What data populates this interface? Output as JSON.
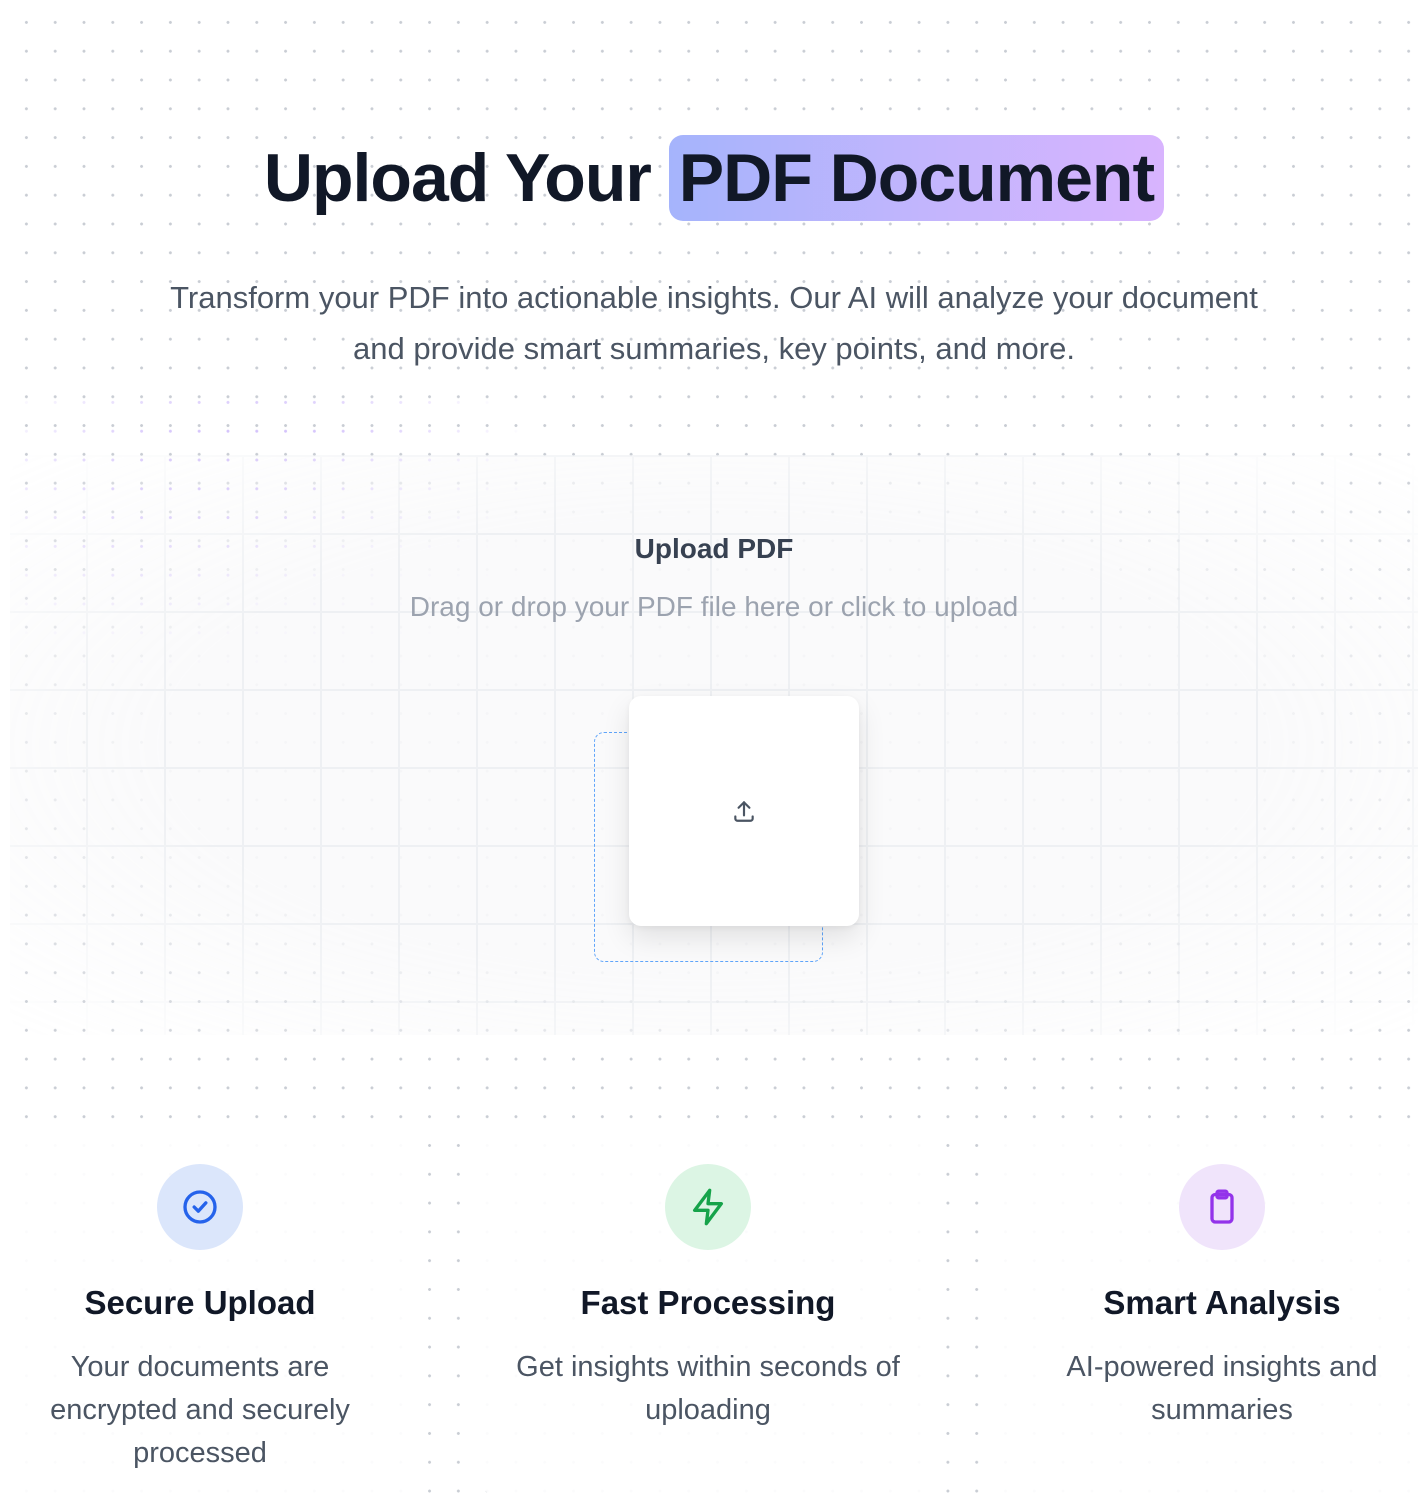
{
  "hero": {
    "title_plain": "Upload Your",
    "title_highlight": "PDF Document",
    "subtitle_line1": "Transform your PDF into actionable insights. Our AI will analyze your document",
    "subtitle_line2": "and provide smart summaries, key points, and more."
  },
  "upload": {
    "heading": "Upload PDF",
    "hint": "Drag or drop your PDF file here or click to upload",
    "icon": "upload-icon"
  },
  "features": [
    {
      "title": "Secure Upload",
      "description": "Your documents are encrypted and securely processed",
      "icon": "check-circle-icon",
      "icon_color": "#2563eb",
      "bg_color": "#dbe6fb"
    },
    {
      "title": "Fast Processing",
      "description": "Get insights within seconds of uploading",
      "icon": "lightning-bolt-icon",
      "icon_color": "#16a34a",
      "bg_color": "#dcf5e4"
    },
    {
      "title": "Smart Analysis",
      "description": "AI-powered insights and summaries",
      "icon": "clipboard-icon",
      "icon_color": "#9333ea",
      "bg_color": "#f0e4fb"
    }
  ],
  "colors": {
    "accent_gradient_start": "#a5b4fc",
    "accent_gradient_end": "#d8b4fe",
    "dropzone_border": "#60a5fa"
  }
}
